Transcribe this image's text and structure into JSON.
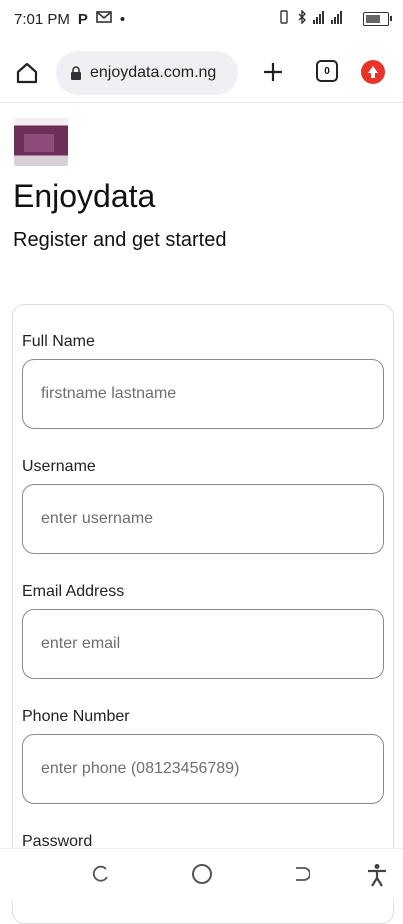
{
  "status_bar": {
    "time": "7:01 PM",
    "left_icons": [
      "parking-icon",
      "mail-icon",
      "dot-icon"
    ],
    "right_icons": [
      "vibrate-icon",
      "bluetooth-icon",
      "signal-icon",
      "battery-icon"
    ]
  },
  "browser": {
    "url": "enjoydata.com.ng",
    "tab_count": "0"
  },
  "header": {
    "brand": "Enjoydata",
    "subtitle": "Register and get started"
  },
  "form": {
    "fields": [
      {
        "label": "Full Name",
        "placeholder": "firstname lastname",
        "value": ""
      },
      {
        "label": "Username",
        "placeholder": "enter username",
        "value": ""
      },
      {
        "label": "Email Address",
        "placeholder": "enter email",
        "value": ""
      },
      {
        "label": "Phone Number",
        "placeholder": "enter phone (08123456789)",
        "value": ""
      },
      {
        "label": "Password",
        "placeholder": "",
        "value": ""
      }
    ]
  },
  "colors": {
    "accent_profile": "#e8342b",
    "input_border": "#8a8a8a",
    "card_border": "#dedede"
  }
}
